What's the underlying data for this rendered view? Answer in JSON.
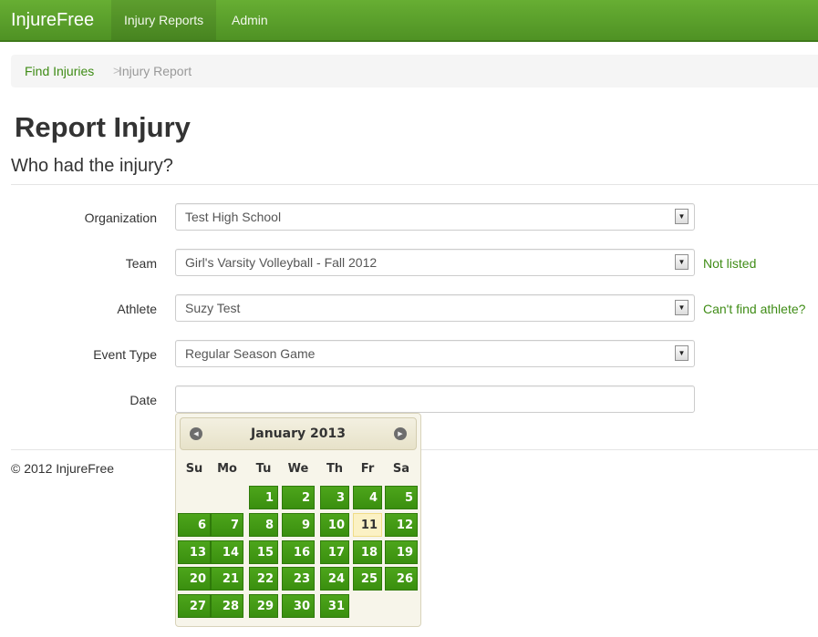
{
  "navbar": {
    "brand": "InjureFree",
    "items": [
      {
        "label": "Injury Reports",
        "active": true
      },
      {
        "label": "Admin",
        "active": false
      }
    ]
  },
  "breadcrumb": {
    "link": "Find Injuries",
    "separator": ">",
    "current": "Injury Report"
  },
  "page": {
    "title": "Report Injury",
    "subtitle": "Who had the injury?"
  },
  "form": {
    "organization": {
      "label": "Organization",
      "value": "Test High School"
    },
    "team": {
      "label": "Team",
      "value": "Girl's Varsity Volleyball - Fall 2012",
      "help": "Not listed"
    },
    "athlete": {
      "label": "Athlete",
      "value": "Suzy Test",
      "help": "Can't find athlete?"
    },
    "event_type": {
      "label": "Event Type",
      "value": "Regular Season Game"
    },
    "date": {
      "label": "Date",
      "value": ""
    }
  },
  "datepicker": {
    "month_label": "January 2013",
    "prev_icon": "circle-triangle-w",
    "next_icon": "circle-triangle-e",
    "weekdays": [
      "Su",
      "Mo",
      "Tu",
      "We",
      "Th",
      "Fr",
      "Sa"
    ],
    "first_weekday_index": 2,
    "days_in_month": 31,
    "today": 11,
    "colors": {
      "day_bg": "#3f9713",
      "today_bg": "#fbf1c4"
    }
  },
  "footer": {
    "copyright": "© 2012 InjureFree"
  }
}
